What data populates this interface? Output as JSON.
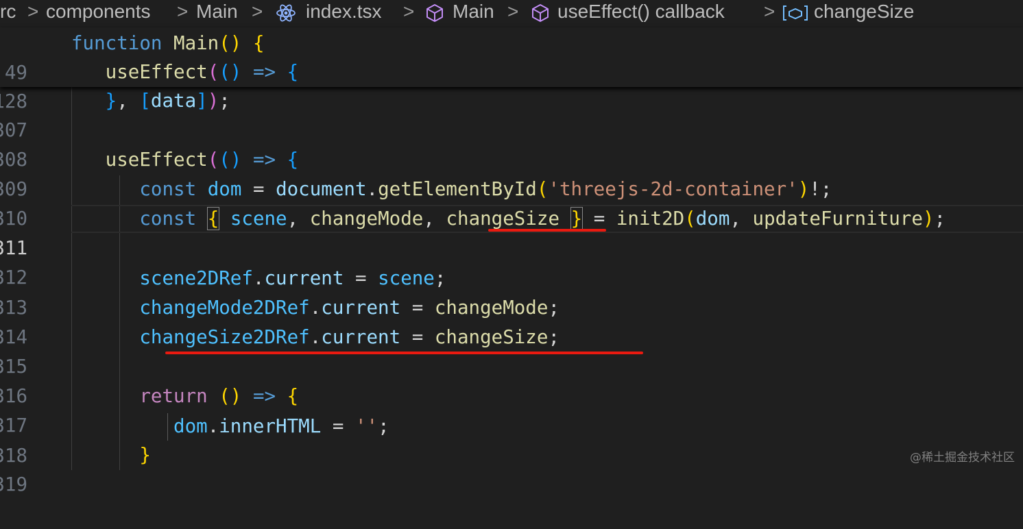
{
  "breadcrumb": {
    "items": [
      "rc",
      "components",
      "Main",
      "index.tsx",
      "Main",
      "useEffect() callback",
      "changeSize"
    ],
    "separator": ">"
  },
  "editor": {
    "lines": [
      {
        "num": "49",
        "text": "function Main() {"
      },
      {
        "num": "128",
        "text": "useEffect(() => {"
      },
      {
        "num": "307",
        "text": "}, [data]);"
      },
      {
        "num": "308",
        "text": ""
      },
      {
        "num": "309",
        "text": "useEffect(() => {"
      },
      {
        "num": "310",
        "text": "const dom = document.getElementById('threejs-2d-container')!;"
      },
      {
        "num": "311",
        "text": "const { scene, changeMode, changeSize } = init2D(dom, updateFurniture);"
      },
      {
        "num": "312",
        "text": ""
      },
      {
        "num": "313",
        "text": "scene2DRef.current = scene;"
      },
      {
        "num": "314",
        "text": "changeMode2DRef.current = changeMode;"
      },
      {
        "num": "315",
        "text": "changeSize2DRef.current = changeSize;"
      },
      {
        "num": "316",
        "text": ""
      },
      {
        "num": "317",
        "text": "return () => {"
      },
      {
        "num": "318",
        "text": "dom.innerHTML = '';"
      },
      {
        "num": "319",
        "text": "}"
      }
    ]
  },
  "watermark": "@稀土掘金技术社区",
  "colors": {
    "background": "#1f1f1f",
    "annotation": "#ea1a10",
    "keyword": "#569cd6",
    "function": "#dcdcaa",
    "variable": "#9cdcfe"
  }
}
